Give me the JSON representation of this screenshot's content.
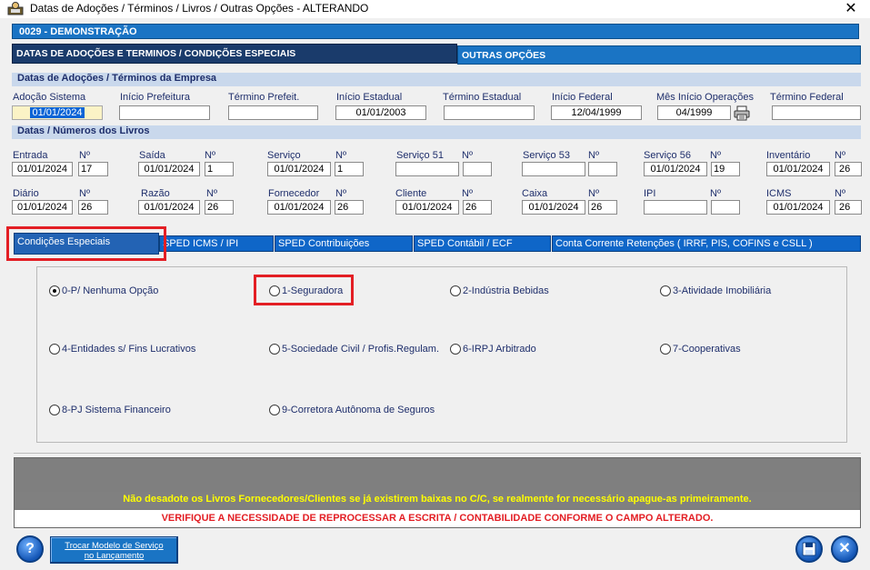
{
  "window": {
    "title": "Datas de Adoções / Términos / Livros / Outras Opções  -   ALTERANDO",
    "close": "✕"
  },
  "company": "0029   -   DEMONSTRAÇÃO",
  "tabs": {
    "datas": "DATAS DE ADOÇÕES E TERMINOS / CONDIÇÕES ESPECIAIS",
    "outras": "OUTRAS OPÇÕES"
  },
  "section1": {
    "title": "Datas de Adoções / Términos da Empresa",
    "fields": [
      {
        "label": "Adoção Sistema",
        "value": "01/01/2024"
      },
      {
        "label": "Início Prefeitura",
        "value": ""
      },
      {
        "label": "Término Prefeit.",
        "value": ""
      },
      {
        "label": "Início Estadual",
        "value": "01/01/2003"
      },
      {
        "label": "Término Estadual",
        "value": ""
      },
      {
        "label": "Início Federal",
        "value": "12/04/1999"
      },
      {
        "label": "Mês Início Operações",
        "value": "04/1999"
      },
      {
        "label": "Término Federal",
        "value": ""
      }
    ]
  },
  "section2": {
    "title": "Datas / Números dos Livros",
    "num_label": "Nº",
    "row1": [
      {
        "label": "Entrada",
        "date": "01/01/2024",
        "num": "17"
      },
      {
        "label": "Saída",
        "date": "01/01/2024",
        "num": "1"
      },
      {
        "label": "Serviço",
        "date": "01/01/2024",
        "num": "1"
      },
      {
        "label": "Serviço 51",
        "date": "",
        "num": ""
      },
      {
        "label": "Serviço 53",
        "date": "",
        "num": ""
      },
      {
        "label": "Serviço 56",
        "date": "01/01/2024",
        "num": "19"
      },
      {
        "label": "Inventário",
        "date": "01/01/2024",
        "num": "26"
      }
    ],
    "row2": [
      {
        "label": "Diário",
        "date": "01/01/2024",
        "num": "26"
      },
      {
        "label": "Razão",
        "date": "01/01/2024",
        "num": "26"
      },
      {
        "label": "Fornecedor",
        "date": "01/01/2024",
        "num": "26"
      },
      {
        "label": "Cliente",
        "date": "01/01/2024",
        "num": "26"
      },
      {
        "label": "Caixa",
        "date": "01/01/2024",
        "num": "26"
      },
      {
        "label": "IPI",
        "date": "",
        "num": ""
      },
      {
        "label": "ICMS",
        "date": "01/01/2024",
        "num": "26"
      }
    ]
  },
  "subtabs": [
    "Condições Especiais",
    "SPED ICMS / IPI",
    "SPED Contribuições",
    "SPED Contábil / ECF",
    "Conta Corrente Retenções ( IRRF,  PIS,  COFINS  e  CSLL )"
  ],
  "options": [
    "0-P/ Nenhuma Opção",
    "1-Seguradora",
    "2-Indústria Bebidas",
    "3-Atividade Imobiliária",
    "4-Entidades s/ Fins Lucrativos",
    "5-Sociedade Civil / Profis.Regulam.",
    "6-IRPJ Arbitrado",
    "7-Cooperativas",
    "8-PJ Sistema Financeiro",
    "9-Corretora Autônoma de Seguros"
  ],
  "selected_option": 0,
  "warnings": {
    "yellow": "Não desadote os Livros Fornecedores/Clientes se já existirem baixas no C/C, se realmente for necessário apague-as primeiramente.",
    "red": "VERIFIQUE A NECESSIDADE DE REPROCESSAR A ESCRITA / CONTABILIDADE CONFORME O CAMPO ALTERADO."
  },
  "buttons": {
    "help": "?",
    "trocar_line1": "Trocar Modelo de Serviço",
    "trocar_line2": "no Lançamento",
    "close": "✕"
  },
  "colors": {
    "accent": "#1a74c4",
    "highlight": "#e31e24",
    "warning_text": "#ffff00"
  }
}
